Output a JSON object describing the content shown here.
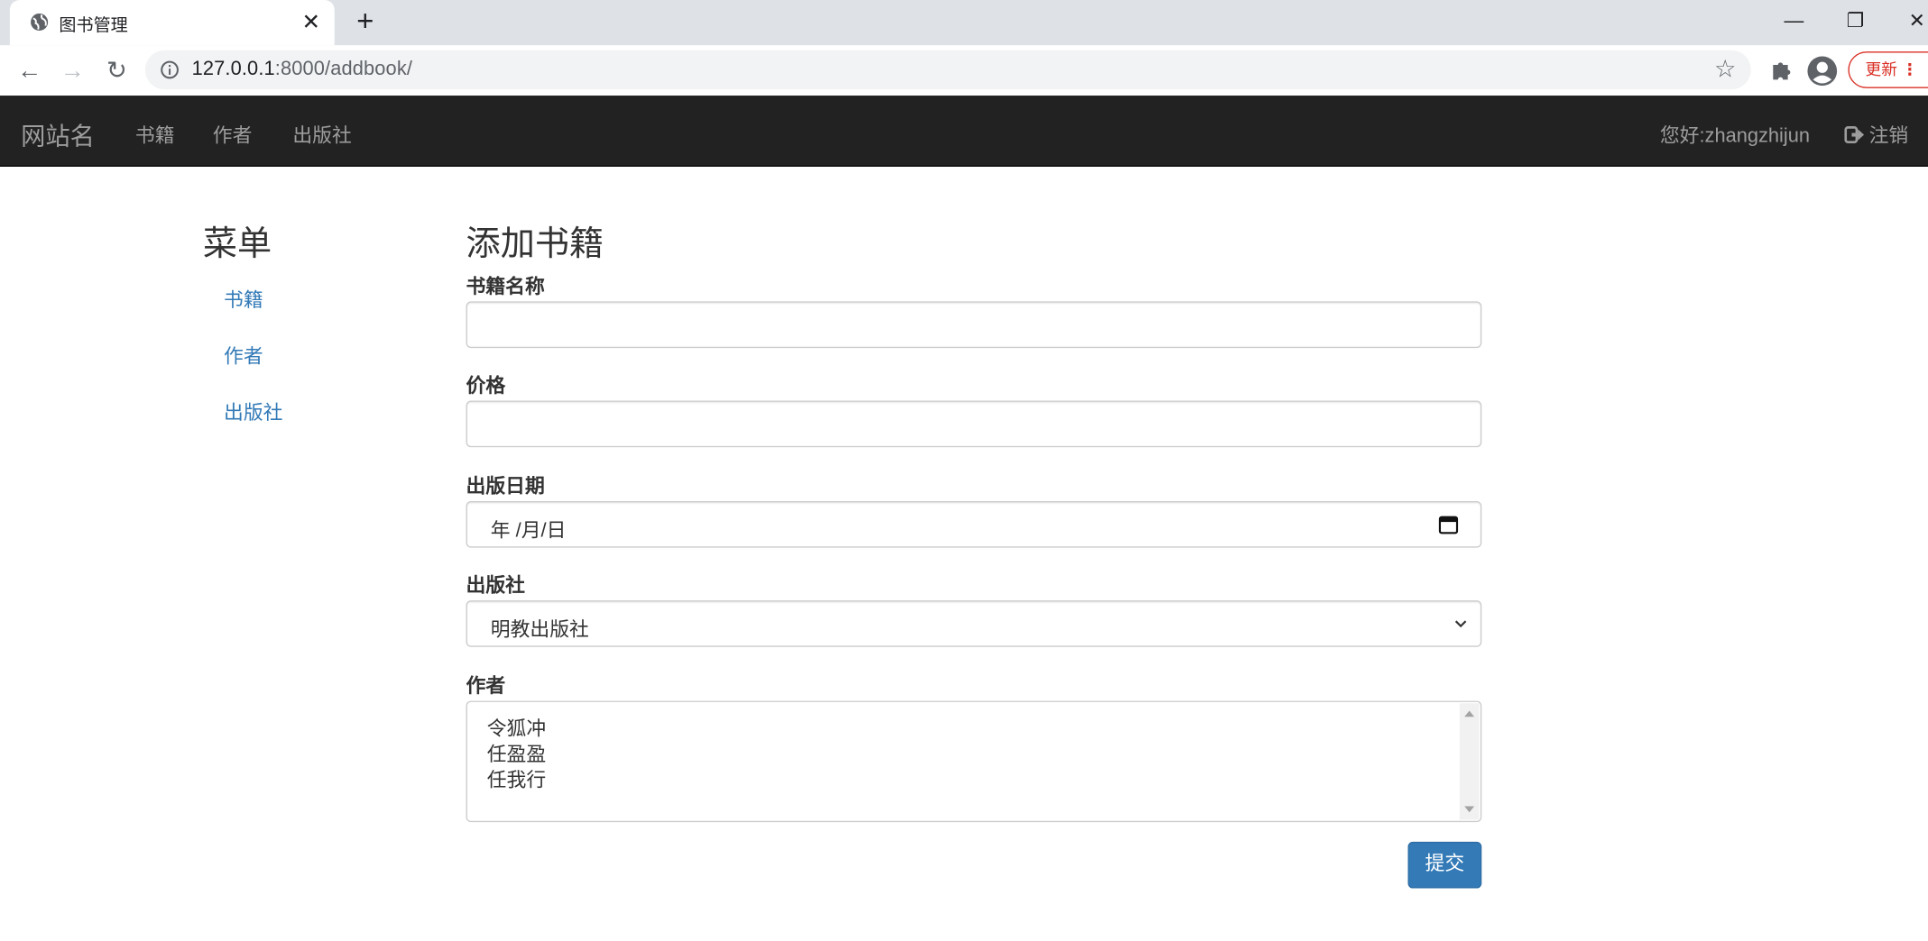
{
  "browser": {
    "tab_title": "图书管理",
    "url_host": "127.0.0.1",
    "url_path": ":8000/addbook/",
    "update_label": "更新"
  },
  "navbar": {
    "brand": "网站名",
    "links": [
      "书籍",
      "作者",
      "出版社"
    ],
    "greeting": "您好:zhangzhijun",
    "logout_label": "注销"
  },
  "sidebar": {
    "title": "菜单",
    "items": [
      "书籍",
      "作者",
      "出版社"
    ]
  },
  "form": {
    "title": "添加书籍",
    "fields": {
      "name_label": "书籍名称",
      "name_value": "",
      "price_label": "价格",
      "price_value": "",
      "date_label": "出版日期",
      "date_placeholder": "年 /月/日",
      "publisher_label": "出版社",
      "publisher_selected": "明教出版社",
      "author_label": "作者",
      "author_options": [
        "令狐冲",
        "任盈盈",
        "任我行"
      ]
    },
    "submit_label": "提交"
  },
  "colors": {
    "navbar_bg": "#222222",
    "link": "#337ab7",
    "primary_button": "#337ab7"
  }
}
